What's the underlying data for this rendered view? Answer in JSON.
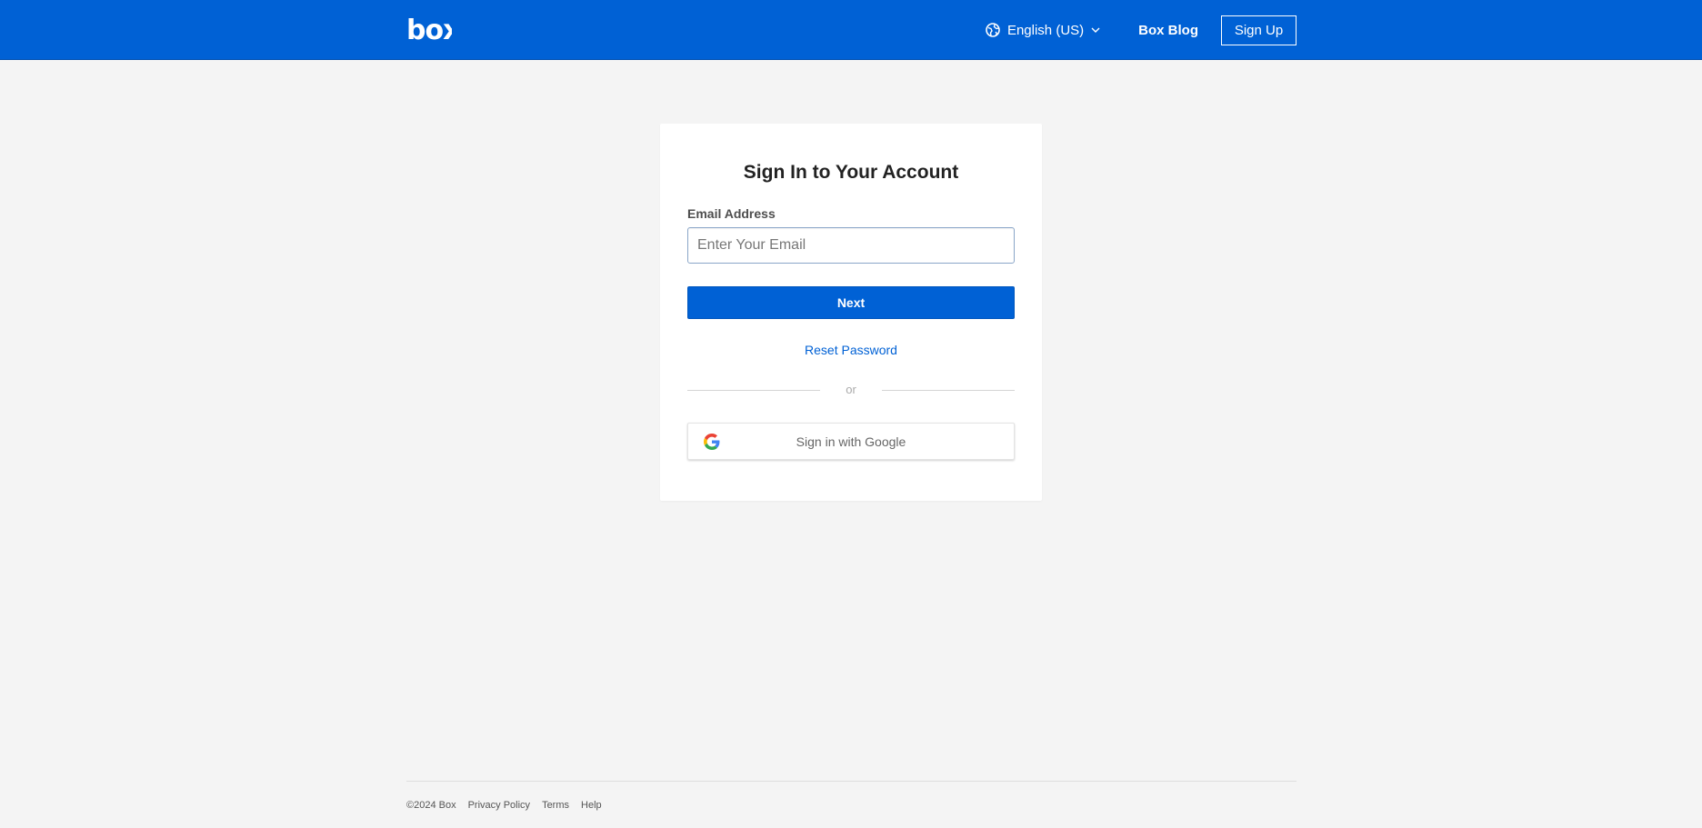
{
  "header": {
    "logo_text": "box",
    "language_label": "English (US)",
    "blog_label": "Box Blog",
    "signup_label": "Sign Up"
  },
  "card": {
    "title": "Sign In to Your Account",
    "email_label": "Email Address",
    "email_placeholder": "Enter Your Email",
    "email_value": "",
    "next_label": "Next",
    "reset_label": "Reset Password",
    "divider_text": "or",
    "google_label": "Sign in with Google"
  },
  "footer": {
    "copyright": "©2024 Box",
    "links": [
      "Privacy Policy",
      "Terms",
      "Help"
    ]
  },
  "colors": {
    "brand": "#0061d5",
    "background": "#f4f4f4"
  }
}
